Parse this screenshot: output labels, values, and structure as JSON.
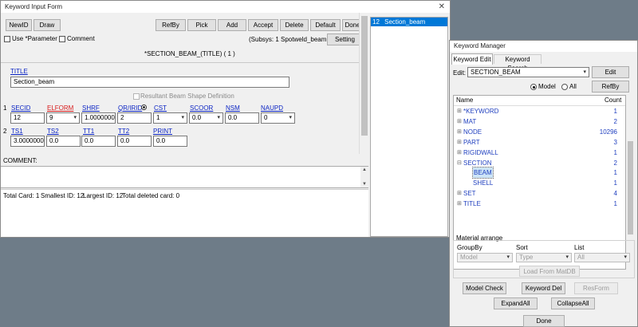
{
  "keyword_form": {
    "title": "Keyword Input Form",
    "close_glyph": "✕",
    "buttons": {
      "newid": "NewID",
      "draw": "Draw",
      "refby": "RefBy",
      "pick": "Pick",
      "add": "Add",
      "accept": "Accept",
      "delete": "Delete",
      "default": "Default",
      "done": "Done",
      "setting": "Setting"
    },
    "use_parameter_label": "Use *Parameter",
    "comment_check_label": "Comment",
    "subsys": "(Subsys: 1 Spotweld_beam.k)",
    "keyword_heading": "*SECTION_BEAM_(TITLE)  ( 1 )",
    "title_label": "TITLE",
    "title_value": "Section_beam",
    "resultant_label": "Resultant Beam Shape Definition",
    "row1": {
      "num": "1",
      "labels": [
        "SECID",
        "ELFORM",
        "SHRF",
        "QR/IRID",
        "CST",
        "SCOOR",
        "NSM",
        "NAUPD"
      ],
      "secid": "12",
      "elform": "9",
      "shrf": "1.0000000",
      "qr_irid": "2",
      "cst": "1",
      "scoor": "0.0",
      "nsm": "0.0",
      "naupd": "0"
    },
    "row2": {
      "num": "2",
      "labels": [
        "TS1",
        "TS2",
        "TT1",
        "TT2",
        "PRINT"
      ],
      "values": [
        "3.0000000",
        "0.0",
        "0.0",
        "0.0",
        "0.0"
      ]
    },
    "comment_label": "COMMENT:",
    "status": {
      "total_card": "Total Card: 1",
      "smallest_id": "Smallest ID: 12",
      "largest_id": "Largest ID: 12",
      "total_deleted": "Total deleted card:  0"
    },
    "id_list": [
      {
        "id": "12",
        "name": "Section_beam"
      }
    ]
  },
  "keyword_manager": {
    "title": "Keyword Manager",
    "tabs": [
      "Keyword Edit",
      "Keyword Search"
    ],
    "edit_label": "Edit:",
    "edit_value": "SECTION_BEAM",
    "edit_button": "Edit",
    "radio_model": "Model",
    "radio_all": "All",
    "refby_button": "RefBy",
    "columns": {
      "name": "Name",
      "count": "Count"
    },
    "tree": [
      {
        "name": "*KEYWORD",
        "count": "1",
        "level": 0,
        "expander": "⊞"
      },
      {
        "name": "MAT",
        "count": "2",
        "level": 0,
        "expander": "⊞"
      },
      {
        "name": "NODE",
        "count": "10296",
        "level": 0,
        "expander": "⊞"
      },
      {
        "name": "PART",
        "count": "3",
        "level": 0,
        "expander": "⊞"
      },
      {
        "name": "RIGIDWALL",
        "count": "1",
        "level": 0,
        "expander": "⊞"
      },
      {
        "name": "SECTION",
        "count": "2",
        "level": 0,
        "expander": "⊟"
      },
      {
        "name": "BEAM",
        "count": "1",
        "level": 1,
        "expander": "",
        "selected": true
      },
      {
        "name": "SHELL",
        "count": "1",
        "level": 1,
        "expander": ""
      },
      {
        "name": "SET",
        "count": "4",
        "level": 0,
        "expander": "⊞"
      },
      {
        "name": "TITLE",
        "count": "1",
        "level": 0,
        "expander": "⊞"
      }
    ],
    "material_arrange": "Material arrange",
    "groupby_label": "GroupBy",
    "groupby_value": "Model",
    "sort_label": "Sort",
    "sort_value": "Type",
    "list_label": "List",
    "list_value": "All",
    "load_matdb": "Load From MatDB",
    "model_check": "Model Check",
    "keyword_del": "Keyword Del",
    "resform": "ResForm",
    "expand_all": "ExpandAll",
    "collapse_all": "CollapseAll",
    "done": "Done"
  },
  "colors": {
    "link": "#0b24c4",
    "required_link": "#d81b1b",
    "selection": "#0078d7",
    "desktop": "#6e7c88"
  }
}
